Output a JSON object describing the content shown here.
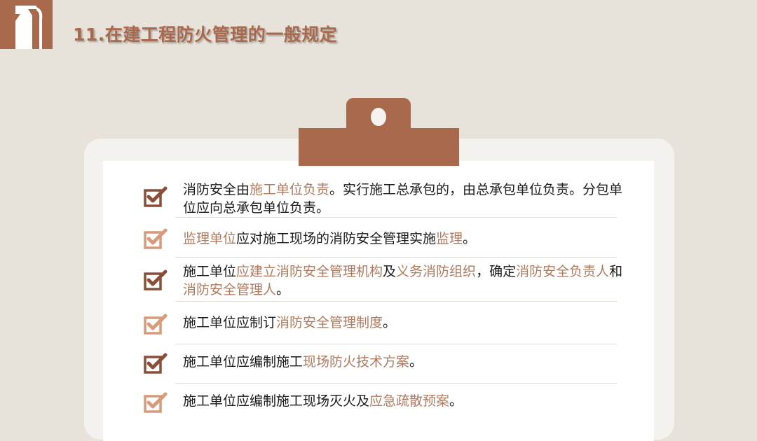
{
  "title": "11.在建工程防火管理的一般规定",
  "colors": {
    "accent": "#a8694c",
    "highlight": "#b07a5e",
    "check_dark": "#8a4f38",
    "check_light": "#d99a7a",
    "background": "#e8e3da"
  },
  "icons": {
    "logo": "fire-extinguisher-icon",
    "bullet": "checkbox-checked-icon"
  },
  "items": [
    {
      "parts": [
        {
          "t": "消防安全由"
        },
        {
          "t": "施工单位负责",
          "hl": true
        },
        {
          "t": "。实行施工总承包的，由总承包单位负责。分包单位应向总承包单位负责。"
        }
      ]
    },
    {
      "parts": [
        {
          "t": "监理单位",
          "hl": true
        },
        {
          "t": "应对施工现场的消防安全管理实施"
        },
        {
          "t": "监理",
          "hl": true
        },
        {
          "t": "。"
        }
      ]
    },
    {
      "parts": [
        {
          "t": "施工单位"
        },
        {
          "t": "应建立消防安全管理机构",
          "hl": true
        },
        {
          "t": "及"
        },
        {
          "t": "义务消防组织",
          "hl": true
        },
        {
          "t": "，确定"
        },
        {
          "t": "消防安全负责人",
          "hl": true
        },
        {
          "t": "和"
        },
        {
          "t": "消防安全管理人",
          "hl": true
        },
        {
          "t": "。"
        }
      ]
    },
    {
      "parts": [
        {
          "t": "施工单位应制订"
        },
        {
          "t": "消防安全管理制度",
          "hl": true
        },
        {
          "t": "。"
        }
      ]
    },
    {
      "parts": [
        {
          "t": "施工单位应编制施工"
        },
        {
          "t": "现场防火技术方案",
          "hl": true
        },
        {
          "t": "。"
        }
      ]
    },
    {
      "parts": [
        {
          "t": "施工单位应编制施工现场灭火及"
        },
        {
          "t": "应急疏散预案",
          "hl": true
        },
        {
          "t": "。"
        }
      ]
    }
  ]
}
